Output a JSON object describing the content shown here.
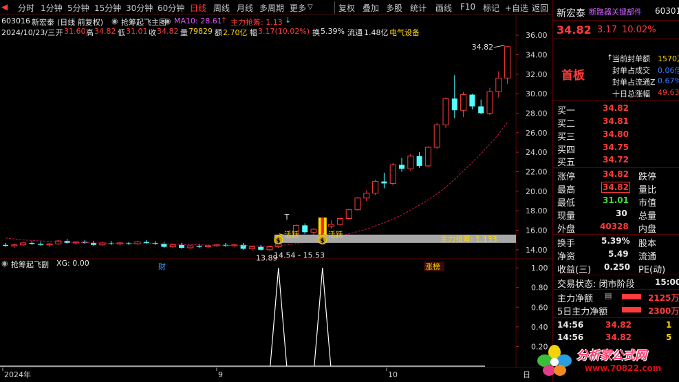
{
  "toolbar": {
    "periods": [
      "分时",
      "1分钟",
      "5分钟",
      "15分钟",
      "30分钟",
      "60分钟",
      "日线",
      "周线",
      "月线",
      "多周期",
      "更多"
    ],
    "active_period": "日线",
    "more_arrow": "▽",
    "actions": [
      "复权",
      "叠加",
      "多股",
      "统计",
      "画线",
      "F10",
      "标记",
      "+自选",
      "返回"
    ]
  },
  "info": {
    "code": "603016",
    "name": "新宏泰",
    "mode": "(日线 前复权)",
    "formula": "抢筹起飞主图",
    "ma10": "MA10: 28.61",
    "ma10_arrow": "↑",
    "zl": "主力抢筹: 1.13",
    "zl_arrow": "↓",
    "date": "2024/10/23/三",
    "open_label": "开",
    "open": "31.60",
    "high_label": "高",
    "high": "34.82",
    "low_label": "低",
    "low": "31.01",
    "close_label": "收",
    "close": "34.82",
    "vol_label": "量",
    "vol": "79829",
    "amt_label": "额",
    "amt": "2.70亿",
    "chg_label": "幅",
    "chg": "3.17(10.02%)",
    "turnover_label": "换",
    "turnover": "5.39%",
    "float_label": "流通",
    "float": "1.48亿",
    "sector": "电气设备"
  },
  "price_axis": [
    "36.00",
    "34.00",
    "32.00",
    "30.00",
    "28.00",
    "26.00",
    "24.00",
    "22.00",
    "20.00",
    "18.00",
    "16.00",
    "14.00"
  ],
  "annotations": {
    "peak": "34.82",
    "trough": "13.89",
    "range": "14.54 - 15.53",
    "active1": "活跃",
    "active2": "活跃",
    "zl_band": "主力抢筹: 1.133",
    "marker_cai": "财",
    "marker_zhang": "涨榜",
    "letter_t": "T"
  },
  "sub_chart": {
    "title": "抢筹起飞副",
    "xg": "XG: 0.00",
    "axis": [
      "1.00",
      "0.80",
      "0.60",
      "0.40",
      "0.20"
    ]
  },
  "date_axis": [
    "2024年",
    "9",
    "10"
  ],
  "date_axis_right": "日",
  "chart_data": {
    "type": "candlestick",
    "candles": [
      {
        "o": 14.5,
        "h": 14.7,
        "l": 14.3,
        "c": 14.4
      },
      {
        "o": 14.4,
        "h": 14.6,
        "l": 14.2,
        "c": 14.5
      },
      {
        "o": 14.5,
        "h": 14.8,
        "l": 14.4,
        "c": 14.7
      },
      {
        "o": 14.7,
        "h": 14.9,
        "l": 14.5,
        "c": 14.6
      },
      {
        "o": 14.6,
        "h": 14.8,
        "l": 14.4,
        "c": 14.5
      },
      {
        "o": 14.5,
        "h": 14.7,
        "l": 14.3,
        "c": 14.6
      },
      {
        "o": 14.6,
        "h": 15.0,
        "l": 14.5,
        "c": 14.9
      },
      {
        "o": 14.9,
        "h": 15.1,
        "l": 14.6,
        "c": 14.7
      },
      {
        "o": 14.7,
        "h": 14.9,
        "l": 14.5,
        "c": 14.8
      },
      {
        "o": 14.8,
        "h": 15.0,
        "l": 14.6,
        "c": 14.7
      },
      {
        "o": 14.7,
        "h": 14.9,
        "l": 14.4,
        "c": 14.5
      },
      {
        "o": 14.5,
        "h": 14.8,
        "l": 14.4,
        "c": 14.7
      },
      {
        "o": 14.7,
        "h": 14.9,
        "l": 14.5,
        "c": 14.6
      },
      {
        "o": 14.6,
        "h": 14.8,
        "l": 14.4,
        "c": 14.7
      },
      {
        "o": 14.7,
        "h": 14.8,
        "l": 14.5,
        "c": 14.6
      },
      {
        "o": 14.6,
        "h": 14.9,
        "l": 14.5,
        "c": 14.8
      },
      {
        "o": 14.8,
        "h": 15.0,
        "l": 14.6,
        "c": 14.7
      },
      {
        "o": 14.7,
        "h": 14.9,
        "l": 14.5,
        "c": 14.6
      },
      {
        "o": 14.6,
        "h": 14.8,
        "l": 14.2,
        "c": 14.3
      },
      {
        "o": 14.3,
        "h": 14.6,
        "l": 14.2,
        "c": 14.5
      },
      {
        "o": 14.5,
        "h": 14.7,
        "l": 14.1,
        "c": 14.2
      },
      {
        "o": 14.2,
        "h": 14.5,
        "l": 14.1,
        "c": 14.4
      },
      {
        "o": 14.4,
        "h": 14.6,
        "l": 14.2,
        "c": 14.3
      },
      {
        "o": 14.3,
        "h": 14.5,
        "l": 14.2,
        "c": 14.4
      },
      {
        "o": 14.4,
        "h": 14.6,
        "l": 14.3,
        "c": 14.5
      },
      {
        "o": 14.5,
        "h": 14.7,
        "l": 14.3,
        "c": 14.4
      },
      {
        "o": 14.4,
        "h": 14.6,
        "l": 14.3,
        "c": 14.5
      },
      {
        "o": 14.5,
        "h": 14.7,
        "l": 14.0,
        "c": 14.1
      },
      {
        "o": 14.1,
        "h": 14.4,
        "l": 13.9,
        "c": 14.3
      },
      {
        "o": 14.3,
        "h": 14.5,
        "l": 13.9,
        "c": 14.0
      },
      {
        "o": 14.0,
        "h": 14.4,
        "l": 13.89,
        "c": 14.3
      },
      {
        "o": 14.3,
        "h": 15.2,
        "l": 14.2,
        "c": 15.1
      },
      {
        "o": 15.1,
        "h": 15.6,
        "l": 14.9,
        "c": 15.4
      },
      {
        "o": 15.4,
        "h": 16.6,
        "l": 15.3,
        "c": 16.5
      },
      {
        "o": 16.5,
        "h": 16.7,
        "l": 15.6,
        "c": 15.8
      },
      {
        "o": 15.8,
        "h": 16.2,
        "l": 15.5,
        "c": 16.1
      },
      {
        "o": 16.1,
        "h": 16.6,
        "l": 15.9,
        "c": 16.4
      },
      {
        "o": 16.4,
        "h": 17.0,
        "l": 16.2,
        "c": 16.6
      },
      {
        "o": 16.6,
        "h": 17.3,
        "l": 16.5,
        "c": 17.2
      },
      {
        "o": 17.2,
        "h": 18.2,
        "l": 17.1,
        "c": 18.1
      },
      {
        "o": 18.1,
        "h": 19.4,
        "l": 18.0,
        "c": 19.3
      },
      {
        "o": 19.3,
        "h": 20.1,
        "l": 19.0,
        "c": 19.8
      },
      {
        "o": 19.8,
        "h": 21.2,
        "l": 19.6,
        "c": 21.0
      },
      {
        "o": 21.0,
        "h": 21.9,
        "l": 20.3,
        "c": 20.8
      },
      {
        "o": 20.8,
        "h": 22.9,
        "l": 20.6,
        "c": 22.7
      },
      {
        "o": 22.7,
        "h": 23.4,
        "l": 22.0,
        "c": 22.3
      },
      {
        "o": 22.3,
        "h": 23.8,
        "l": 22.1,
        "c": 23.6
      },
      {
        "o": 23.6,
        "h": 24.0,
        "l": 22.4,
        "c": 22.6
      },
      {
        "o": 22.6,
        "h": 24.6,
        "l": 22.5,
        "c": 24.5
      },
      {
        "o": 24.5,
        "h": 27.0,
        "l": 24.3,
        "c": 26.8
      },
      {
        "o": 26.8,
        "h": 29.6,
        "l": 26.5,
        "c": 29.5
      },
      {
        "o": 29.5,
        "h": 31.9,
        "l": 27.5,
        "c": 28.3
      },
      {
        "o": 28.3,
        "h": 30.2,
        "l": 27.6,
        "c": 29.9
      },
      {
        "o": 29.9,
        "h": 30.0,
        "l": 28.4,
        "c": 28.7
      },
      {
        "o": 28.7,
        "h": 29.4,
        "l": 27.9,
        "c": 28.0
      },
      {
        "o": 28.0,
        "h": 30.6,
        "l": 27.8,
        "c": 30.2
      },
      {
        "o": 30.2,
        "h": 32.3,
        "l": 29.6,
        "c": 31.6
      },
      {
        "o": 31.6,
        "h": 34.82,
        "l": 31.01,
        "c": 34.82
      }
    ],
    "ma10": [
      15.2,
      15.1,
      15.0,
      14.95,
      14.9,
      14.85,
      14.8,
      14.78,
      14.75,
      14.72,
      14.7,
      14.68,
      14.66,
      14.65,
      14.64,
      14.63,
      14.62,
      14.62,
      14.6,
      14.58,
      14.55,
      14.53,
      14.5,
      14.48,
      14.46,
      14.45,
      14.44,
      14.42,
      14.4,
      14.38,
      14.36,
      14.42,
      14.5,
      14.63,
      14.75,
      14.9,
      15.06,
      15.23,
      15.41,
      15.62,
      15.87,
      16.12,
      16.44,
      16.78,
      17.15,
      17.57,
      18.05,
      18.57,
      19.12,
      19.72,
      20.42,
      21.22,
      22.08,
      22.95,
      23.85,
      24.8,
      25.85,
      27.05
    ],
    "xg": [
      0,
      0,
      0,
      0,
      0,
      0,
      0,
      0,
      0,
      0,
      0,
      0,
      0,
      0,
      0,
      0,
      0,
      0,
      0,
      0,
      0,
      0,
      0,
      0,
      0,
      0,
      0,
      0,
      0,
      0,
      0,
      1,
      0,
      0,
      0,
      0,
      0,
      0,
      0,
      0,
      0,
      0,
      0,
      0,
      0,
      0,
      0,
      0,
      0,
      0,
      0,
      0,
      0,
      0,
      0,
      0,
      0,
      0
    ],
    "xg_marker_index": [
      31,
      36
    ],
    "y_range": [
      13.0,
      36.5
    ],
    "sub_y_range": [
      0,
      1.05
    ]
  },
  "quote": {
    "name": "新宏泰",
    "scroll": "断路器关键部件",
    "code": "60301",
    "price": "34.82",
    "change": "3.17",
    "pct": "10.02%",
    "board": "首板",
    "seal_lines": [
      {
        "label": "当前封单额",
        "value": "1570万"
      },
      {
        "label": "封单占成交",
        "value": "0.06倍"
      },
      {
        "label": "封单占流通Z",
        "value": "0.67%"
      },
      {
        "label": "十日总涨幅",
        "value": "49.63%"
      }
    ],
    "bids": [
      {
        "label": "买一",
        "price": "34.82"
      },
      {
        "label": "买二",
        "price": "34.81"
      },
      {
        "label": "买三",
        "price": "34.80"
      },
      {
        "label": "买四",
        "price": "34.75"
      },
      {
        "label": "买五",
        "price": "34.72"
      }
    ],
    "stats": [
      {
        "l": "涨停",
        "v": "34.82",
        "vc": "red",
        "r": "跌停"
      },
      {
        "l": "最高",
        "v": "34.82",
        "vc": "red-box",
        "r": "量比"
      },
      {
        "l": "最低",
        "v": "31.01",
        "vc": "green",
        "r": "市值"
      },
      {
        "l": "现量",
        "v": "30",
        "vc": "white",
        "r": "总量"
      },
      {
        "l": "外盘",
        "v": "40328",
        "vc": "red",
        "r": "内盘"
      }
    ],
    "stats2": [
      {
        "l": "换手",
        "v": "5.39%",
        "r": "股本"
      },
      {
        "l": "净资",
        "v": "5.49",
        "r": "流通"
      },
      {
        "l": "收益(三)",
        "v": "0.250",
        "r": "PE(动)"
      }
    ],
    "trade_state": "交易状态: 闭市阶段",
    "trade_time": "15:00",
    "net_inflow_label": "主力净额",
    "net_inflow": "2125万",
    "net5_label": "5日主力净额",
    "net5": "2300万",
    "ticks": [
      {
        "t": "14:56",
        "p": "34.82",
        "v": "1"
      },
      {
        "t": "14:56",
        "p": "34.82",
        "v": "5"
      }
    ],
    "watermark": "分析家公式网",
    "watermark_url": "www.70822.com"
  },
  "colors": {
    "up": "#ff3b3b",
    "down": "#54ffff",
    "ma": "#d01060",
    "grid": "#5a0000",
    "zl_band": "#a8a8a8"
  }
}
